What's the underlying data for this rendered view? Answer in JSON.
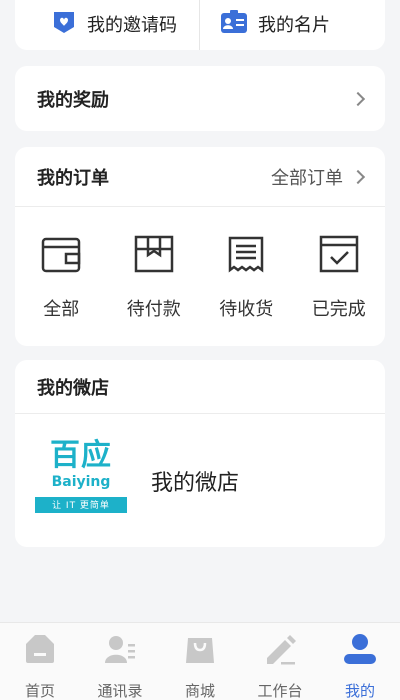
{
  "top": {
    "invite_label": "我的邀请码",
    "card_label": "我的名片"
  },
  "rewards": {
    "title": "我的奖励"
  },
  "orders": {
    "title": "我的订单",
    "all_label": "全部订单",
    "items": [
      {
        "label": "全部",
        "icon": "wallet-icon"
      },
      {
        "label": "待付款",
        "icon": "package-icon"
      },
      {
        "label": "待收货",
        "icon": "receipt-icon"
      },
      {
        "label": "已完成",
        "icon": "checked-box-icon"
      }
    ]
  },
  "shop": {
    "title": "我的微店",
    "logo_cn": "百应",
    "logo_en": "Baiying",
    "logo_slogan": "让 IT 更简单",
    "name": "我的微店"
  },
  "tabbar": {
    "items": [
      {
        "label": "首页",
        "icon": "home-icon"
      },
      {
        "label": "通讯录",
        "icon": "contacts-icon"
      },
      {
        "label": "商城",
        "icon": "shopping-bag-icon"
      },
      {
        "label": "工作台",
        "icon": "pen-icon"
      },
      {
        "label": "我的",
        "icon": "user-icon"
      }
    ],
    "active_index": 4
  },
  "colors": {
    "accent": "#3b6fd8",
    "logo": "#1db1c9",
    "icon_gray": "#c8c8c8",
    "background": "#f4f5f7"
  }
}
